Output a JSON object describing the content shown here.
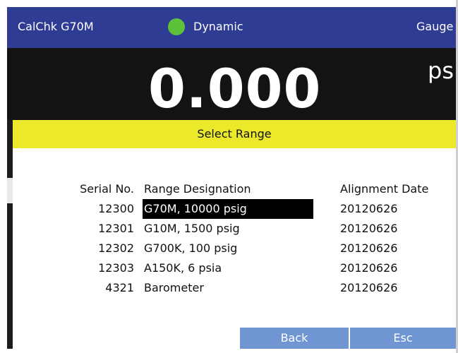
{
  "header": {
    "app_title": "CalChk G70M",
    "status_label": "Dynamic",
    "status_color": "#5cc23a",
    "mode_label": "Gauge"
  },
  "reading": {
    "value": "0.000",
    "unit": "psi"
  },
  "dialog": {
    "title": "Select Range",
    "title_color": "#ece92b",
    "columns": {
      "serial": "Serial No.",
      "range": "Range Designation",
      "date": "Alignment Date"
    },
    "rows": [
      {
        "serial": "12300",
        "range": "G70M, 10000 psig",
        "date": "20120626",
        "selected": true
      },
      {
        "serial": "12301",
        "range": "G10M, 1500 psig",
        "date": "20120626",
        "selected": false
      },
      {
        "serial": "12302",
        "range": "G700K, 100 psig",
        "date": "20120626",
        "selected": false
      },
      {
        "serial": "12303",
        "range": "A150K, 6 psia",
        "date": "20120626",
        "selected": false
      },
      {
        "serial": "4321",
        "range": "Barometer",
        "date": "20120626",
        "selected": false
      }
    ],
    "buttons": {
      "back": "Back",
      "esc": "Esc"
    }
  }
}
